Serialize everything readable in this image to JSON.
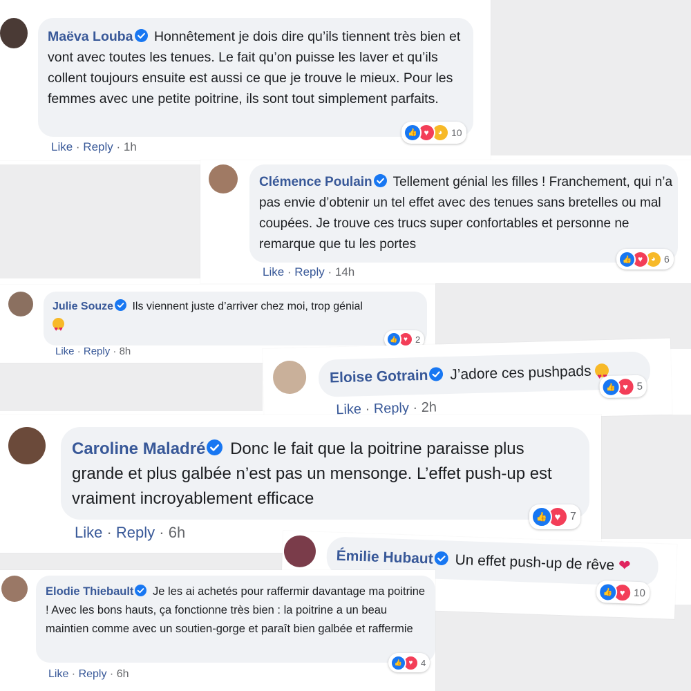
{
  "comments": [
    {
      "name": "Maëva Louba",
      "text": "Honnêtement je dois dire qu’ils tiennent très bien et vont avec toutes les tenues. Le fait qu’on puisse les laver et qu’ils collent toujours ensuite est aussi ce que je trouve le mieux. Pour les femmes avec une petite poitrine, ils sont tout simplement parfaits.",
      "like": "Like",
      "reply": "Reply",
      "time": "1h",
      "count": "10",
      "avatar_color": "#4a3a35"
    },
    {
      "name": "Clémence Poulain",
      "text": "Tellement génial les filles ! Franchement, qui n’a pas envie d’obtenir un tel effet avec des tenues sans bretelles ou mal coupées. Je trouve ces trucs super confortables et personne ne remarque que tu les portes",
      "like": "Like",
      "reply": "Reply",
      "time": "14h",
      "count": "6",
      "avatar_color": "#a07a64"
    },
    {
      "name": "Julie Souze",
      "text": "Ils viennent juste d’arriver chez moi, trop génial",
      "like": "Like",
      "reply": "Reply",
      "time": "8h",
      "count": "2",
      "avatar_color": "#8b7060"
    },
    {
      "name": "Eloise Gotrain",
      "text": "J’adore ces pushpads",
      "like": "Like",
      "reply": "Reply",
      "time": "2h",
      "count": "5",
      "avatar_color": "#c9b09a"
    },
    {
      "name": "Caroline Maladré",
      "text": "Donc le fait que la poitrine paraisse plus grande et plus galbée n’est pas un mensonge. L’effet push-up est vraiment incroyablement efficace",
      "like": "Like",
      "reply": "Reply",
      "time": "6h",
      "count": "7",
      "avatar_color": "#6b4a3a"
    },
    {
      "name": "Émilie Hubaut",
      "text": "Un effet push-up de rêve",
      "count": "10",
      "avatar_color": "#7a3c4a"
    },
    {
      "name": "Elodie Thiebault",
      "text": "Je les ai achetés pour raffermir davantage ma poitrine ! Avec les bons hauts, ça fonctionne très bien : la poitrine a un beau maintien comme avec un soutien-gorge et paraît bien galbée et raffermie",
      "like": "Like",
      "reply": "Reply",
      "time": "6h",
      "count": "4",
      "avatar_color": "#9a7866"
    }
  ],
  "colors": {
    "name": "#385898",
    "bubble": "#f0f2f5",
    "like": "#1877f2",
    "love": "#f33e58",
    "haha": "#f7b928"
  }
}
